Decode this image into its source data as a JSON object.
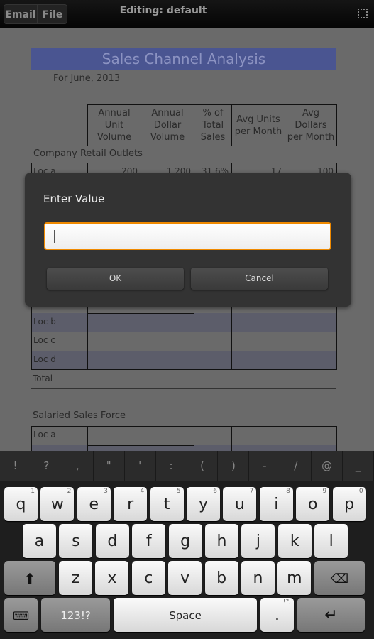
{
  "topbar": {
    "buttons": [
      "Email",
      "File"
    ],
    "title": "Editing: default",
    "fullscreen_icon": "fullscreen-icon"
  },
  "document": {
    "title": "Sales Channel Analysis",
    "subtitle": "For June, 2013",
    "headers": [
      "Annual Unit Volume",
      "Annual Dollar Volume",
      "% of Total Sales",
      "Avg Units per Month",
      "Avg Dollars per Month"
    ],
    "section1": {
      "label": "Company Retail Outlets",
      "rows": [
        {
          "label": "Loc a",
          "values": [
            "200",
            "1,200",
            "31.6%",
            "17",
            "100"
          ]
        },
        {
          "label": "Loc b",
          "values": []
        },
        {
          "label": "Loc c",
          "values": []
        },
        {
          "label": "Loc d",
          "values": []
        }
      ],
      "total": "Total"
    },
    "section2": {
      "label": "Salaried Sales Force",
      "rows": [
        {
          "label": "Loc a",
          "values": []
        }
      ]
    },
    "colors": {
      "title_bar": "#4a5591",
      "stripe": "#5c5d6a"
    }
  },
  "dialog": {
    "title": "Enter Value",
    "input_value": "",
    "ok": "OK",
    "cancel": "Cancel",
    "focus_color": "#f08a00"
  },
  "keyboard": {
    "symbols": [
      "!",
      "?",
      ",",
      "\"",
      "'",
      ":",
      "(",
      ")",
      "-",
      "/",
      "@",
      "_"
    ],
    "row1": [
      "q",
      "w",
      "e",
      "r",
      "t",
      "y",
      "u",
      "i",
      "o",
      "p"
    ],
    "row1_sup": [
      "1",
      "2",
      "3",
      "4",
      "5",
      "6",
      "7",
      "8",
      "9",
      "0"
    ],
    "row2": [
      "a",
      "s",
      "d",
      "f",
      "g",
      "h",
      "j",
      "k",
      "l"
    ],
    "row3": [
      "z",
      "x",
      "c",
      "v",
      "b",
      "n",
      "m"
    ],
    "mode": "123!?",
    "space": "Space",
    "period": ".",
    "period_sup": "!?,"
  }
}
